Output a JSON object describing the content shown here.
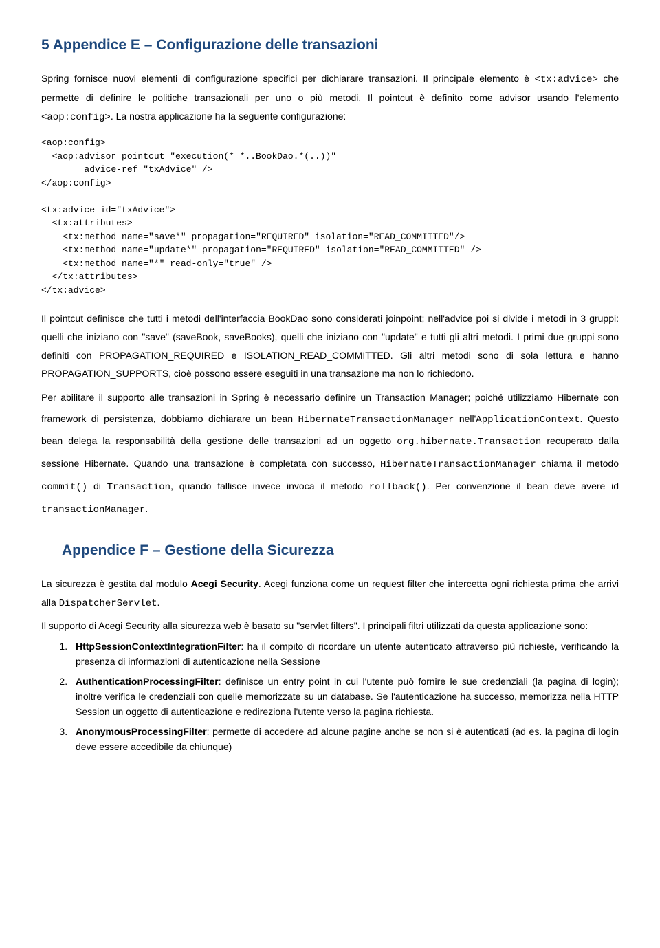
{
  "h1": "5 Appendice E – Configurazione delle transazioni",
  "p1a": "Spring fornisce nuovi elementi di configurazione specifici per dichiarare transazioni. Il principale elemento è ",
  "p1b": "<tx:advice>",
  "p1c": " che permette di definire le politiche transazionali per uno o più metodi. Il pointcut è definito come advisor usando l'elemento ",
  "p1d": "<aop:config>",
  "p1e": ". La nostra applicazione ha la seguente configurazione:",
  "code1": "<aop:config>\n  <aop:advisor pointcut=\"execution(* *..BookDao.*(..))\"\n        advice-ref=\"txAdvice\" />\n</aop:config>\n\n<tx:advice id=\"txAdvice\">\n  <tx:attributes>\n    <tx:method name=\"save*\" propagation=\"REQUIRED\" isolation=\"READ_COMMITTED\"/>\n    <tx:method name=\"update*\" propagation=\"REQUIRED\" isolation=\"READ_COMMITTED\" />\n    <tx:method name=\"*\" read-only=\"true\" />\n  </tx:attributes>\n</tx:advice>",
  "p2": "Il pointcut definisce che tutti i metodi dell'interfaccia BookDao sono considerati joinpoint; nell'advice poi si divide i metodi in 3 gruppi: quelli che iniziano con \"save\" (saveBook, saveBooks), quelli che iniziano con \"update\" e tutti gli altri metodi. I primi due gruppi sono definiti con PROPAGATION_REQUIRED e ISOLATION_READ_COMMITTED. Gli altri metodi sono di sola lettura e hanno PROPAGATION_SUPPORTS, cioè possono essere eseguiti in una transazione ma non lo richiedono.",
  "p3a": "Per abilitare il supporto alle transazioni in Spring è necessario definire un Transaction Manager; poiché utilizziamo Hibernate con framework di persistenza, dobbiamo dichiarare un bean ",
  "p3b": "HibernateTransactionManager",
  "p3c": " nell'",
  "p3d": "ApplicationContext",
  "p3e": ". Questo bean delega la responsabilità della gestione delle transazioni ad un oggetto ",
  "p3f": "org.hibernate.Transaction",
  "p3g": " recuperato dalla sessione Hibernate. Quando una transazione è completata con successo, ",
  "p3h": "HibernateTransactionManager",
  "p3i": " chiama il metodo ",
  "p3j": "commit()",
  "p3k": " di ",
  "p3l": "Transaction",
  "p3m": ", quando fallisce invece invoca il metodo ",
  "p3n": "rollback()",
  "p3o": ". Per convenzione il bean deve avere id ",
  "p3p": "transactionManager",
  "p3q": ".",
  "h2": "Appendice F – Gestione della Sicurezza",
  "p4a": "La sicurezza è gestita dal modulo ",
  "p4b": "Acegi Security",
  "p4c": ". Acegi funziona come un request filter che intercetta ogni richiesta prima che arrivi alla ",
  "p4d": "DispatcherServlet",
  "p4e": ".",
  "p5": "Il supporto di Acegi Security alla sicurezza web è basato su \"servlet filters\". I principali filtri utilizzati da questa applicazione sono:",
  "li1a": "HttpSessionContextIntegrationFilter",
  "li1b": ": ha il compito di ricordare un utente autenticato attraverso più richieste, verificando la presenza di informazioni di autenticazione nella Sessione",
  "li2a": "AuthenticationProcessingFilter",
  "li2b": ": definisce un entry point in cui l'utente può fornire le sue credenziali (la pagina di login); inoltre verifica le credenziali con quelle memorizzate su un database. Se l'autenticazione ha successo, memorizza nella HTTP Session un oggetto di autenticazione e redireziona l'utente verso la pagina richiesta.",
  "li3a": "AnonymousProcessingFilter",
  "li3b": ": permette di accedere ad alcune pagine anche se non si è autenticati (ad es. la pagina di login deve essere accedibile da chiunque)"
}
